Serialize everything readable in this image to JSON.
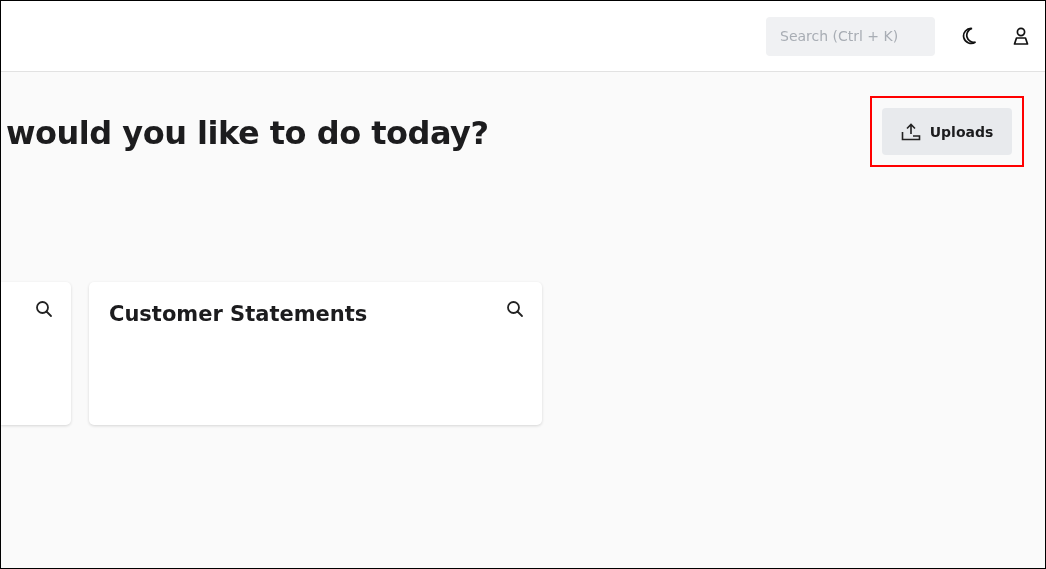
{
  "header": {
    "search": {
      "placeholder": "Search (Ctrl + K)"
    }
  },
  "heading": "would you like to do today?",
  "uploads_button": {
    "label": "Uploads",
    "highlighted": true
  },
  "cards": [
    {
      "kind": "cut"
    },
    {
      "kind": "full",
      "title": "Customer Statements"
    }
  ]
}
